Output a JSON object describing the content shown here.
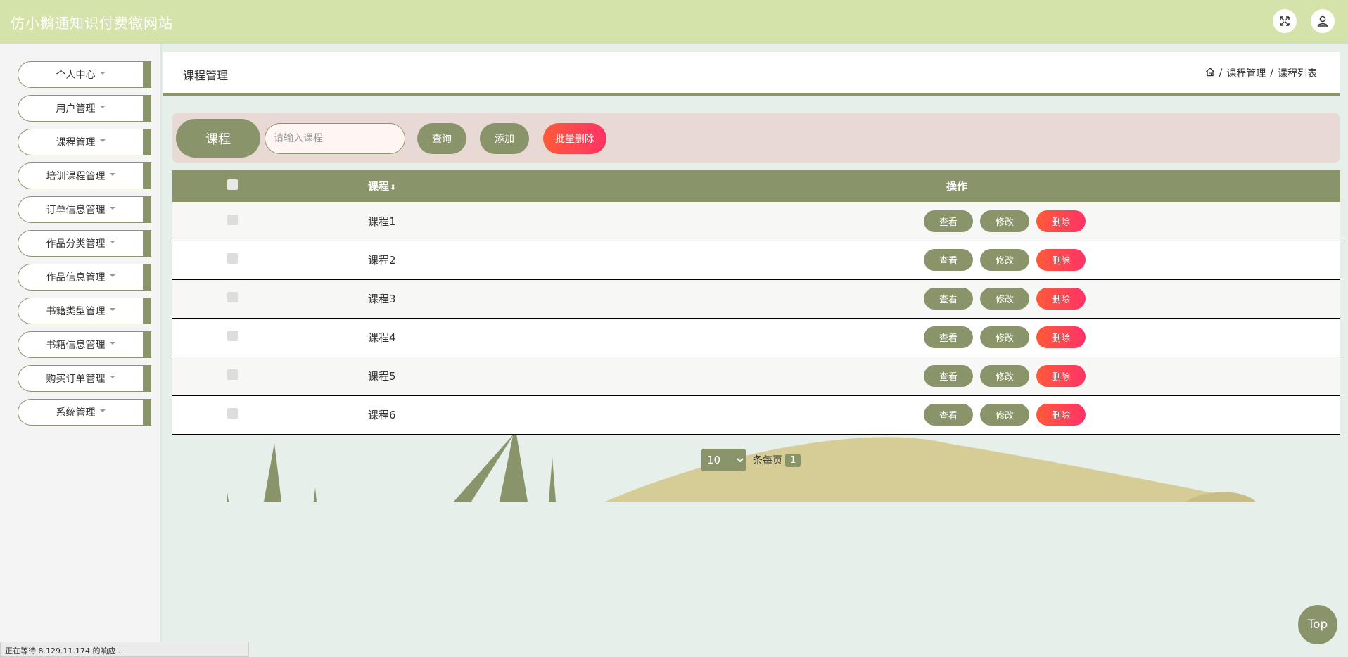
{
  "app": {
    "title": "仿小鹅通知识付费微网站"
  },
  "topbar": {
    "fullscreen_icon": "expand-icon",
    "user_icon": "user-icon"
  },
  "sidebar": {
    "items": [
      {
        "label": "个人中心"
      },
      {
        "label": "用户管理"
      },
      {
        "label": "课程管理"
      },
      {
        "label": "培训课程管理"
      },
      {
        "label": "订单信息管理"
      },
      {
        "label": "作品分类管理"
      },
      {
        "label": "作品信息管理"
      },
      {
        "label": "书籍类型管理"
      },
      {
        "label": "书籍信息管理"
      },
      {
        "label": "购买订单管理"
      },
      {
        "label": "系统管理"
      }
    ]
  },
  "header": {
    "title": "课程管理",
    "breadcrumb": {
      "home_icon": "home-icon",
      "sep": "/",
      "items": [
        "课程管理",
        "课程列表"
      ]
    }
  },
  "search": {
    "label": "课程",
    "placeholder": "请输入课程",
    "query_label": "查询",
    "add_label": "添加",
    "batch_delete_label": "批量删除"
  },
  "table": {
    "columns": {
      "name": "课程",
      "ops": "操作"
    },
    "rows": [
      {
        "name": "课程1"
      },
      {
        "name": "课程2"
      },
      {
        "name": "课程3"
      },
      {
        "name": "课程4"
      },
      {
        "name": "课程5"
      },
      {
        "name": "课程6"
      }
    ],
    "actions": {
      "view": "查看",
      "edit": "修改",
      "delete": "删除"
    }
  },
  "pagination": {
    "page_size": "10",
    "per_page_label": "条每页",
    "current_page": "1"
  },
  "top_button": "Top",
  "status_bar": "正在等待 8.129.11.174 的响应...",
  "colors": {
    "accent": "#8a946a",
    "topbar": "#d3e3a9",
    "danger": "#ff3d5a",
    "page_bg": "#e6efe9"
  }
}
